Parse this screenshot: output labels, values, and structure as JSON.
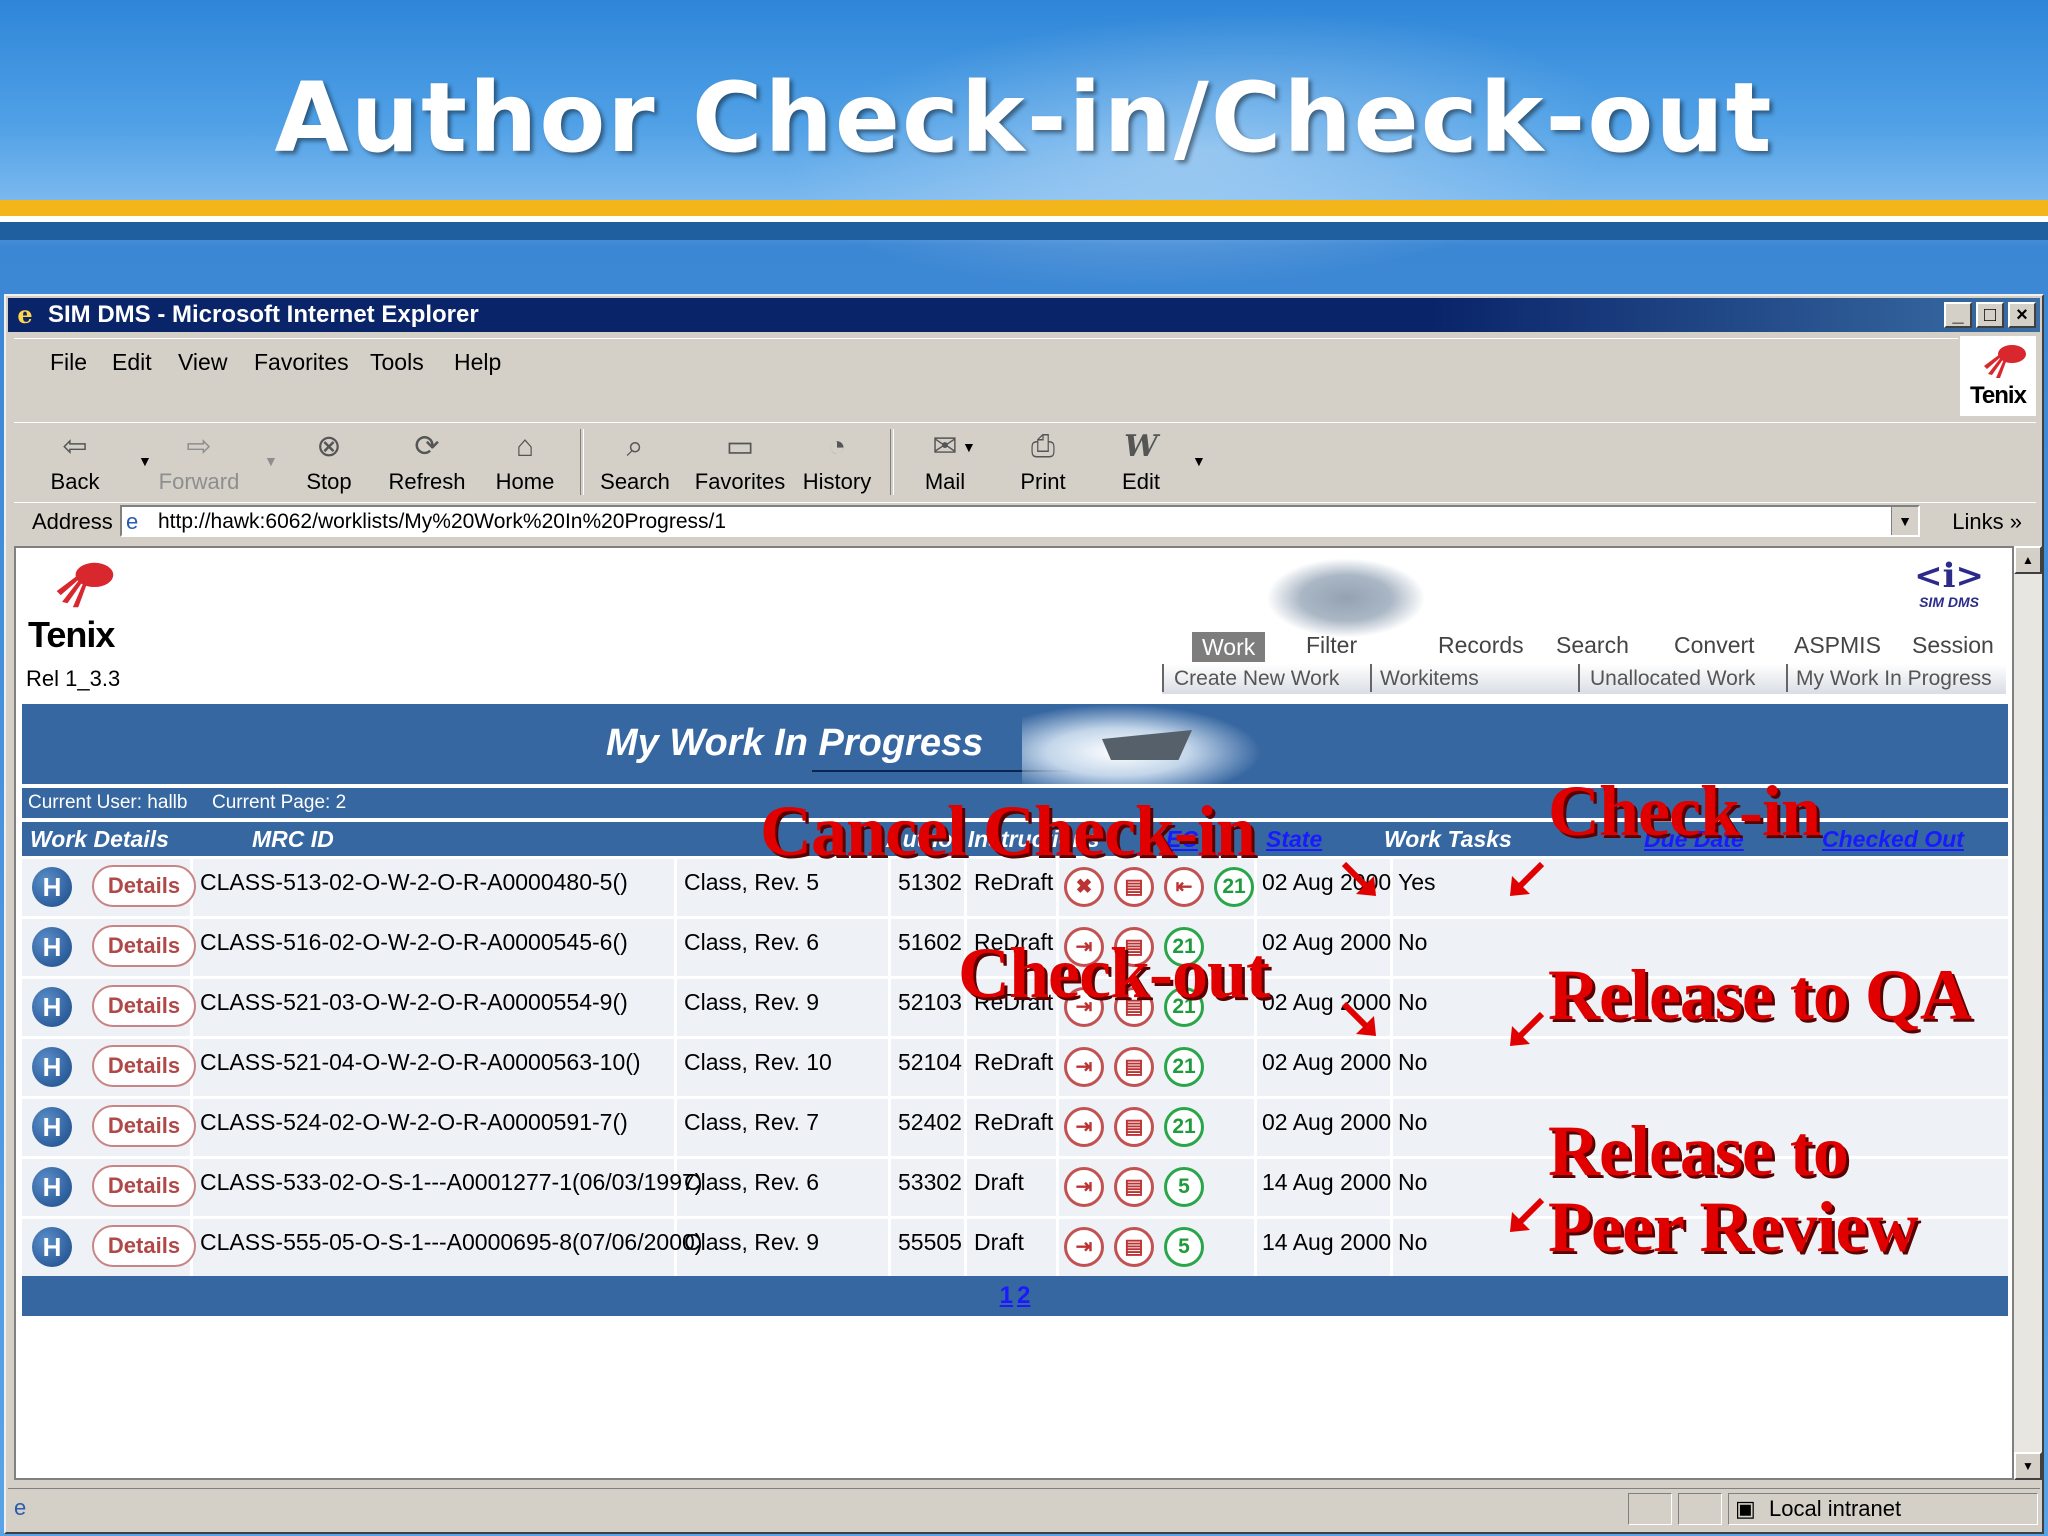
{
  "slide": {
    "title": "Author Check-in/Check-out"
  },
  "browser": {
    "window_title": "SIM DMS - Microsoft Internet Explorer",
    "menu": [
      "File",
      "Edit",
      "View",
      "Favorites",
      "Tools",
      "Help"
    ],
    "brand": "Tenix",
    "toolbar": [
      {
        "label": "Back",
        "icon": "back-arrow-icon"
      },
      {
        "label": "Forward",
        "icon": "forward-arrow-icon"
      },
      {
        "label": "Stop",
        "icon": "stop-icon"
      },
      {
        "label": "Refresh",
        "icon": "refresh-icon"
      },
      {
        "label": "Home",
        "icon": "home-icon"
      },
      {
        "label": "Search",
        "icon": "search-icon"
      },
      {
        "label": "Favorites",
        "icon": "favorites-folder-icon"
      },
      {
        "label": "History",
        "icon": "history-icon"
      },
      {
        "label": "Mail",
        "icon": "mail-icon"
      },
      {
        "label": "Print",
        "icon": "print-icon"
      },
      {
        "label": "Edit",
        "icon": "edit-icon"
      }
    ],
    "address_label": "Address",
    "url": "http://hawk:6062/worklists/My%20Work%20In%20Progress/1",
    "links_label": "Links",
    "status_zone": "Local intranet"
  },
  "app": {
    "brand": "Tenix",
    "release": "Rel 1_3.3",
    "product_mark": "<i>",
    "product_name": "SIM DMS",
    "tabs": [
      "Work",
      "Filter",
      "Records",
      "Search",
      "Convert",
      "ASPMIS",
      "Session"
    ],
    "active_tab": "Work",
    "subtabs": [
      "Create New Work",
      "Workitems",
      "Unallocated Work",
      "My Work In Progress"
    ],
    "page_title": "My Work In Progress",
    "current_user": "Current User: hallb",
    "current_page": "Current Page: 2",
    "columns": [
      "Work Details",
      "MRC ID",
      "Author Instructions",
      "EC",
      "State",
      "Work Tasks",
      "Due Date",
      "Checked Out"
    ],
    "row_h_label": "H",
    "details_label": "Details",
    "rows": [
      {
        "mrc_id": "CLASS-513-02-O-W-2-O-R-A0000480-5()",
        "instructions": "Class, Rev. 5",
        "ec": "51302",
        "state": "ReDraft",
        "tasks": [
          "cancel-checkin-icon",
          "document-icon",
          "checkin-icon"
        ],
        "count": "21",
        "due": "02 Aug 2000",
        "checked_out": "Yes"
      },
      {
        "mrc_id": "CLASS-516-02-O-W-2-O-R-A0000545-6()",
        "instructions": "Class, Rev. 6",
        "ec": "51602",
        "state": "ReDraft",
        "tasks": [
          "checkout-icon",
          "document-icon"
        ],
        "count": "21",
        "due": "02 Aug 2000",
        "checked_out": "No"
      },
      {
        "mrc_id": "CLASS-521-03-O-W-2-O-R-A0000554-9()",
        "instructions": "Class, Rev. 9",
        "ec": "52103",
        "state": "ReDraft",
        "tasks": [
          "checkout-icon",
          "document-icon"
        ],
        "count": "21",
        "due": "02 Aug 2000",
        "checked_out": "No"
      },
      {
        "mrc_id": "CLASS-521-04-O-W-2-O-R-A0000563-10()",
        "instructions": "Class, Rev. 10",
        "ec": "52104",
        "state": "ReDraft",
        "tasks": [
          "checkout-icon",
          "document-icon"
        ],
        "count": "21",
        "due": "02 Aug 2000",
        "checked_out": "No"
      },
      {
        "mrc_id": "CLASS-524-02-O-W-2-O-R-A0000591-7()",
        "instructions": "Class, Rev. 7",
        "ec": "52402",
        "state": "ReDraft",
        "tasks": [
          "checkout-icon",
          "document-icon"
        ],
        "count": "21",
        "due": "02 Aug 2000",
        "checked_out": "No"
      },
      {
        "mrc_id": "CLASS-533-02-O-S-1---A0001277-1(06/03/1997)",
        "instructions": "Class, Rev. 6",
        "ec": "53302",
        "state": "Draft",
        "tasks": [
          "checkout-icon",
          "document-icon"
        ],
        "count": "5",
        "due": "14 Aug 2000",
        "checked_out": "No"
      },
      {
        "mrc_id": "CLASS-555-05-O-S-1---A0000695-8(07/06/2000)",
        "instructions": "Class, Rev. 9",
        "ec": "55505",
        "state": "Draft",
        "tasks": [
          "checkout-icon",
          "document-icon"
        ],
        "count": "5",
        "due": "14 Aug 2000",
        "checked_out": "No"
      }
    ],
    "pages": [
      "1",
      "2"
    ]
  },
  "callouts": {
    "cancel_checkin": "Cancel Check-in",
    "checkin": "Check-in",
    "checkout": "Check-out",
    "release_qa": "Release to QA",
    "release_peer_1": "Release to",
    "release_peer_2": "Peer Review"
  },
  "colors": {
    "callout": "#e00000",
    "grid_header": "#3767a1",
    "titlebar": "#0a246a"
  }
}
